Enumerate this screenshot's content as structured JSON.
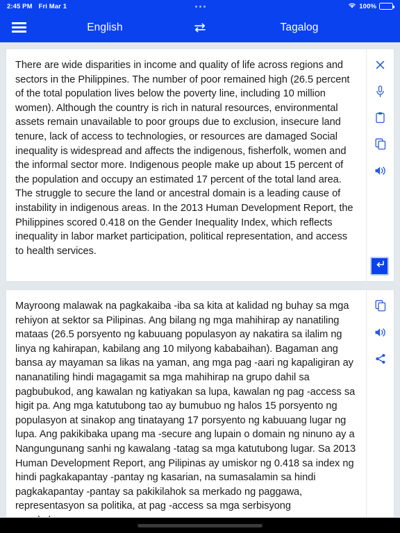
{
  "status_bar": {
    "time": "2:45 PM",
    "date": "Fri Mar 1",
    "battery_percent": "100%",
    "wifi_icon": "wifi-icon",
    "battery_icon": "battery-icon",
    "dots_icon": "status-dots-icon"
  },
  "appbar": {
    "menu_icon": "hamburger-menu-icon",
    "source_language": "English",
    "target_language": "Tagalog",
    "swap_icon": "swap-languages-icon",
    "accent_color": "#0a42f0"
  },
  "source_panel": {
    "text": "There are wide disparities in income and quality of life across regions and sectors in the Philippines. The number of poor remained high (26.5 percent of the total population lives below the poverty line, including 10 million women). Although the country is rich in natural resources, environmental assets remain unavailable to poor groups due to exclusion, insecure land tenure, lack of access to technologies, or resources are damaged Social inequality is widespread and affects the indigenous, fisherfolk, women and the informal sector more. Indigenous people make up about 15 percent of the population and occupy an estimated 17 percent of the total land area. The struggle to secure the land or ancestral domain is a leading cause of instability in indigenous areas. In the 2013 Human Development Report, the Philippines scored 0.418 on the Gender Inequality Index, which reflects inequality in labor market participation, political representation, and access to health services.",
    "actions": [
      {
        "name": "clear-text-button",
        "icon": "close-icon"
      },
      {
        "name": "voice-input-button",
        "icon": "microphone-icon"
      },
      {
        "name": "paste-button",
        "icon": "clipboard-icon"
      },
      {
        "name": "copy-button",
        "icon": "copy-icon"
      },
      {
        "name": "speak-button",
        "icon": "speaker-icon"
      }
    ],
    "submit": {
      "name": "translate-submit-button",
      "icon": "enter-return-icon"
    }
  },
  "target_panel": {
    "text": "Mayroong malawak na pagkakaiba -iba sa kita at kalidad ng buhay sa mga rehiyon at sektor sa Pilipinas. Ang bilang ng mga mahihirap ay nanatiling mataas (26.5 porsyento ng kabuuang populasyon ay nakatira sa ilalim ng linya ng kahirapan, kabilang ang 10 milyong kababaihan). Bagaman ang bansa ay mayaman sa likas na yaman, ang mga pag -aari ng kapaligiran ay nananatiling hindi magagamit sa mga mahihirap na grupo dahil sa pagbubukod, ang kawalan ng katiyakan sa lupa, kawalan ng pag -access sa higit pa. Ang mga katutubong tao ay bumubuo ng halos 15 porsyento ng populasyon at sinakop ang tinatayang 17 porsyento ng kabuuang lugar ng lupa. Ang pakikibaka upang ma -secure ang lupain o domain ng ninuno ay a Nangungunang sanhi ng kawalang -tatag sa mga katutubong lugar. Sa 2013 Human Development Report, ang Pilipinas ay umiskor ng 0.418 sa index ng hindi pagkakapantay -pantay ng kasarian, na sumasalamin sa hindi pagkakapantay -pantay sa pakikilahok sa merkado ng paggawa, representasyon sa politika, at pag -access sa mga serbisyong pangkalusugan.",
    "actions": [
      {
        "name": "copy-translation-button",
        "icon": "copy-icon"
      },
      {
        "name": "speak-translation-button",
        "icon": "speaker-icon"
      },
      {
        "name": "share-translation-button",
        "icon": "share-icon"
      }
    ]
  }
}
